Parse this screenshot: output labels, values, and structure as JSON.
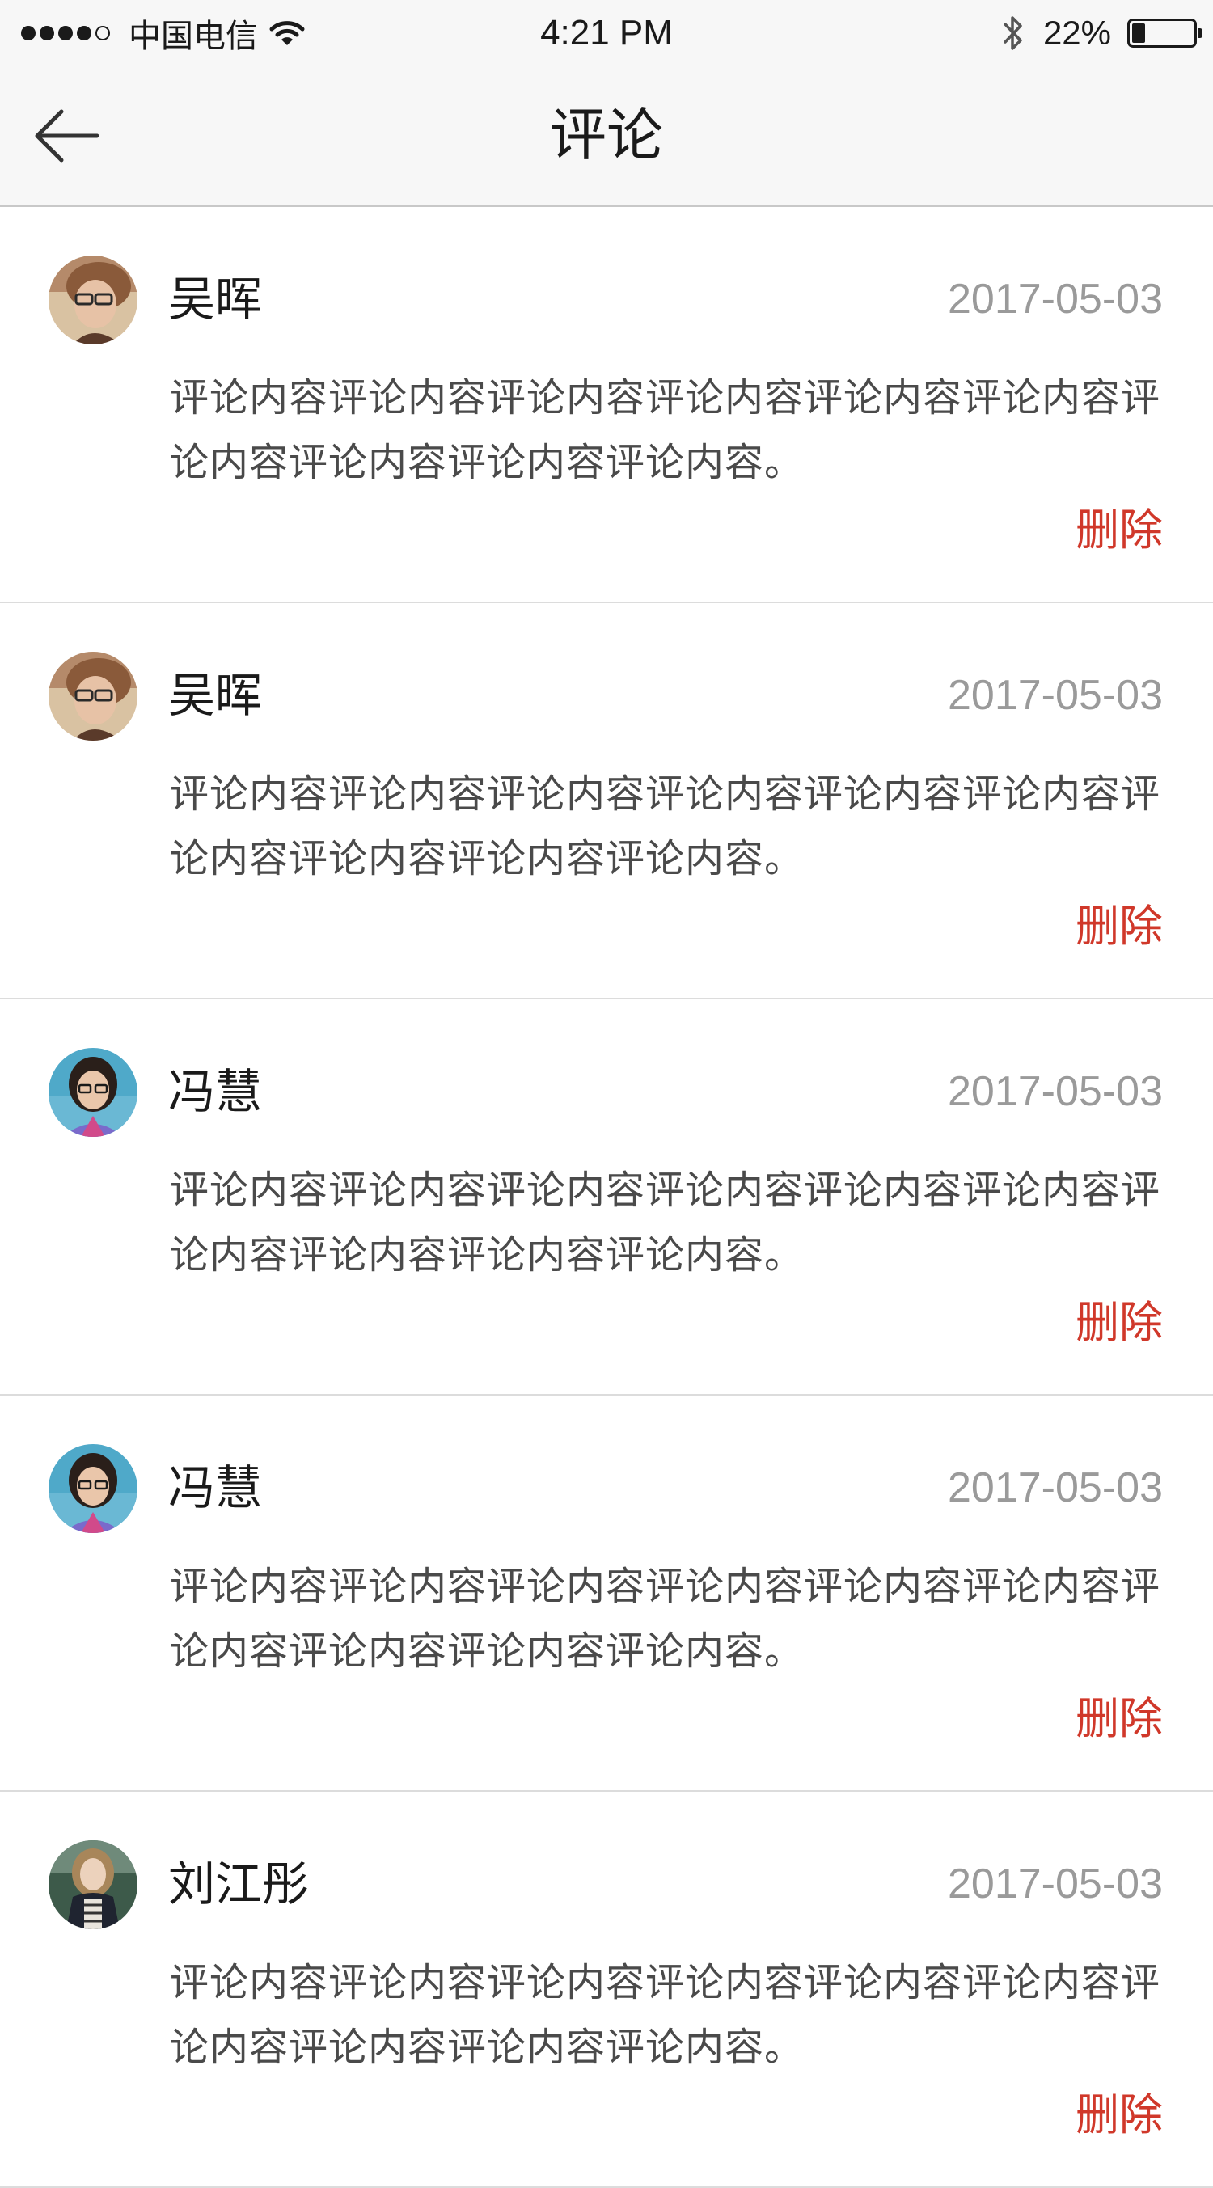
{
  "status_bar": {
    "carrier": "中国电信",
    "time": "4:21 PM",
    "battery_percent": "22%",
    "battery_level": 0.22,
    "signal_strength": 4,
    "icons": [
      "signal-dots-icon",
      "wifi-icon",
      "bluetooth-icon",
      "battery-icon"
    ]
  },
  "nav": {
    "title": "评论",
    "back_icon": "arrow-left-icon"
  },
  "colors": {
    "delete": "#d0382a",
    "date": "#9a9a9a",
    "divider": "#dcdcdc",
    "bar_background": "#f7f7f7"
  },
  "comments": [
    {
      "user": "吴晖",
      "date": "2017-05-03",
      "content": "评论内容评论内容评论内容评论内容评论内容评论内容评论内容评论内容评论内容评论内容。",
      "delete_label": "删除",
      "avatar_icon": "avatar-woman-glasses-icon"
    },
    {
      "user": "吴晖",
      "date": "2017-05-03",
      "content": "评论内容评论内容评论内容评论内容评论内容评论内容评论内容评论内容评论内容评论内容。",
      "delete_label": "删除",
      "avatar_icon": "avatar-woman-glasses-icon"
    },
    {
      "user": "冯慧",
      "date": "2017-05-03",
      "content": "评论内容评论内容评论内容评论内容评论内容评论内容评论内容评论内容评论内容评论内容。",
      "delete_label": "删除",
      "avatar_icon": "avatar-woman-dark-hair-icon"
    },
    {
      "user": "冯慧",
      "date": "2017-05-03",
      "content": "评论内容评论内容评论内容评论内容评论内容评论内容评论内容评论内容评论内容评论内容。",
      "delete_label": "删除",
      "avatar_icon": "avatar-woman-dark-hair-icon"
    },
    {
      "user": "刘江彤",
      "date": "2017-05-03",
      "content": "评论内容评论内容评论内容评论内容评论内容评论内容评论内容评论内容评论内容评论内容。",
      "delete_label": "删除",
      "avatar_icon": "avatar-woman-coat-icon"
    }
  ]
}
